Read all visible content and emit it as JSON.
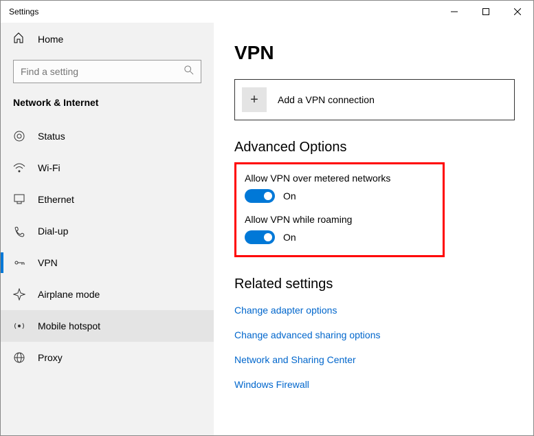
{
  "window": {
    "title": "Settings"
  },
  "sidebar": {
    "home": "Home",
    "search_placeholder": "Find a setting",
    "section": "Network & Internet",
    "items": [
      {
        "label": "Status"
      },
      {
        "label": "Wi-Fi"
      },
      {
        "label": "Ethernet"
      },
      {
        "label": "Dial-up"
      },
      {
        "label": "VPN"
      },
      {
        "label": "Airplane mode"
      },
      {
        "label": "Mobile hotspot"
      },
      {
        "label": "Proxy"
      }
    ]
  },
  "page": {
    "title": "VPN",
    "add_label": "Add a VPN connection",
    "advanced_heading": "Advanced Options",
    "toggle1_label": "Allow VPN over metered networks",
    "toggle1_state": "On",
    "toggle2_label": "Allow VPN while roaming",
    "toggle2_state": "On",
    "related_heading": "Related settings",
    "links": [
      "Change adapter options",
      "Change advanced sharing options",
      "Network and Sharing Center",
      "Windows Firewall"
    ]
  }
}
